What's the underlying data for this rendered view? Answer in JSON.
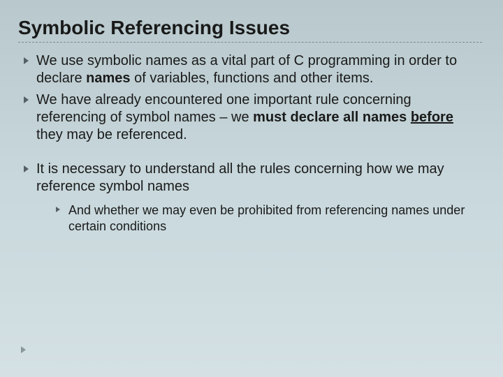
{
  "slide": {
    "title": "Symbolic Referencing Issues",
    "bullets": {
      "b1_pre": "We use symbolic names as a vital part of C programming in order to declare ",
      "b1_bold": "names",
      "b1_post": " of variables, functions and other items.",
      "b2_pre": "We have already encountered one important rule concerning referencing of symbol names – we ",
      "b2_bold1": "must declare all names",
      "b2_mid": " ",
      "b2_bold2": "before",
      "b2_post": " they may be referenced.",
      "b3": "It is necessary to understand all the rules concerning how we may reference symbol names",
      "b3_sub": "And whether we may even be prohibited from referencing names under certain conditions"
    }
  }
}
